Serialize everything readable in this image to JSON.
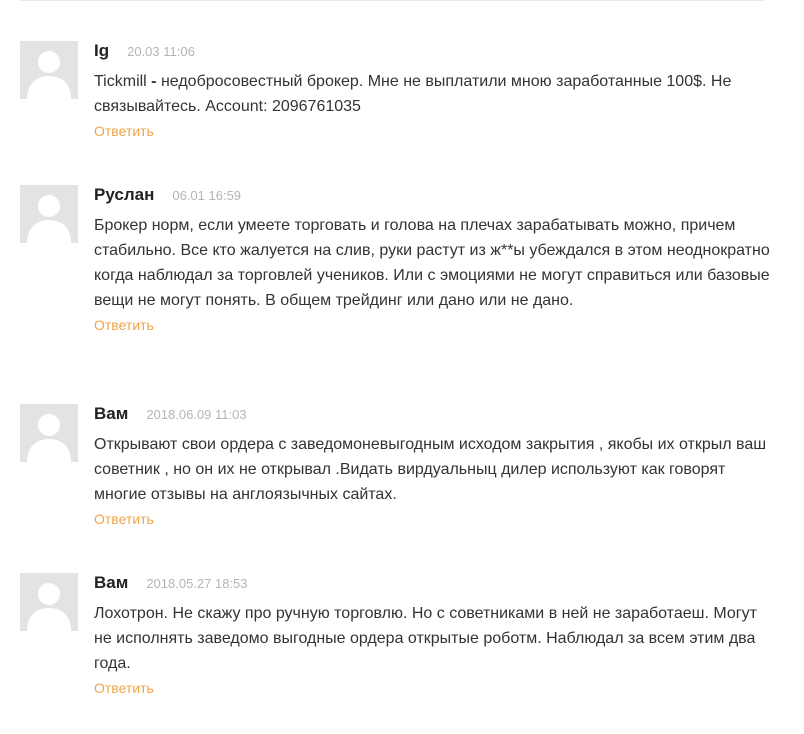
{
  "colors": {
    "reply_link": "#f0a34a",
    "date": "#b5b5b5",
    "text": "#333333",
    "avatar_bg": "#e3e3e3"
  },
  "comments": [
    {
      "author": "Ig",
      "date": "20.03 11:06",
      "text_prefix": "Tickmill",
      "text_sep": " - ",
      "text": "недобросовестный брокер. Мне не выплатили мною заработанные 100$. Не связывайтесь. Account: 2096761035",
      "reply_label": "Ответить",
      "avatar_icon": "user-silhouette"
    },
    {
      "author": "Руслан",
      "date": "06.01 16:59",
      "text": "Брокер норм, если умеете торговать и голова на плечах зарабатывать можно, причем стабильно. Все кто жалуется на слив, руки растут из ж**ы убеждался в этом неоднократно когда наблюдал за торговлей учеников. Или с эмоциями не могут справиться или базовые вещи не могут понять. В общем трейдинг или дано или не дано.",
      "reply_label": "Ответить",
      "avatar_icon": "user-silhouette"
    },
    {
      "author": "Вам",
      "date": "2018.06.09 11:03",
      "text": "Открывают свои  ордера с заведомоневыгодным исходом закрытия , якобы их открыл ваш советник , но он их не открывал .Видать вирдуальныц дилер используют как говорят многие отзывы на англоязычных сайтах.",
      "reply_label": "Ответить",
      "avatar_icon": "user-silhouette"
    },
    {
      "author": "Вам",
      "date": "2018.05.27 18:53",
      "text": "Лохотрон. Не скажу про ручную торговлю. Но с советниками в ней не заработаеш. Могут не исполнять  заведомо выгодные ордера открытые роботм. Наблюдал за всем этим два года.",
      "reply_label": "Ответить",
      "avatar_icon": "user-silhouette"
    }
  ]
}
